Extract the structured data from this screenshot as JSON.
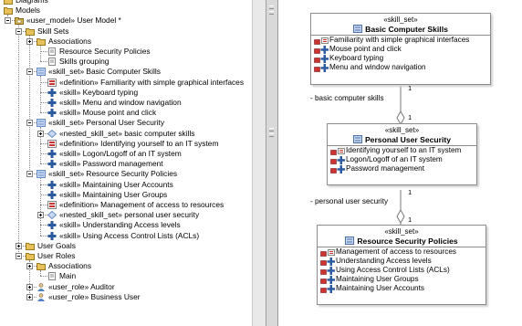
{
  "tree": {
    "rows": [
      {
        "label": "Diagrams",
        "indent": 1,
        "icon": "folder-icon",
        "expander": "plus"
      },
      {
        "label": "Models",
        "indent": 1,
        "icon": "folder-icon",
        "expander": "minus"
      },
      {
        "label": "«user_model» User Model *",
        "indent": 2,
        "icon": "package-icon",
        "expander": "minus"
      },
      {
        "label": "Skill Sets",
        "indent": 3,
        "icon": "folder-icon",
        "expander": "minus"
      },
      {
        "label": "Associations",
        "indent": 4,
        "icon": "folder-icon",
        "expander": "plus"
      },
      {
        "label": "Resource Security Policies",
        "indent": 5,
        "icon": "diagram-icon",
        "expander": ""
      },
      {
        "label": "Skills grouping",
        "indent": 5,
        "icon": "diagram-icon",
        "expander": ""
      },
      {
        "label": "«skill_set» Basic Computer Skills",
        "indent": 4,
        "icon": "skill-set-icon",
        "expander": "minus"
      },
      {
        "label": "«definition» Familiarity with simple graphical interfaces",
        "indent": 5,
        "icon": "definition-icon",
        "expander": ""
      },
      {
        "label": "«skill» Keyboard typing",
        "indent": 5,
        "icon": "skill-icon",
        "expander": ""
      },
      {
        "label": "«skill» Menu and window navigation",
        "indent": 5,
        "icon": "skill-icon",
        "expander": ""
      },
      {
        "label": "«skill» Mouse point and click",
        "indent": 5,
        "icon": "skill-icon",
        "expander": ""
      },
      {
        "label": "«skill_set» Personal User Security",
        "indent": 4,
        "icon": "skill-set-icon",
        "expander": "minus"
      },
      {
        "label": "«nested_skill_set» basic computer skills",
        "indent": 5,
        "icon": "nested-skill-set-icon",
        "expander": "plus"
      },
      {
        "label": "«definition» Identifying yourself to an IT system",
        "indent": 5,
        "icon": "definition-icon",
        "expander": ""
      },
      {
        "label": "«skill» Logon/Logoff of an IT system",
        "indent": 5,
        "icon": "skill-icon",
        "expander": ""
      },
      {
        "label": "«skill» Password management",
        "indent": 5,
        "icon": "skill-icon",
        "expander": ""
      },
      {
        "label": "«skill_set» Resource Security Policies",
        "indent": 4,
        "icon": "skill-set-icon",
        "expander": "minus"
      },
      {
        "label": "«skill» Maintaining User Accounts",
        "indent": 5,
        "icon": "skill-icon",
        "expander": ""
      },
      {
        "label": "«skill» Maintaining User Groups",
        "indent": 5,
        "icon": "skill-icon",
        "expander": ""
      },
      {
        "label": "«definition» Management of access to resources",
        "indent": 5,
        "icon": "definition-icon",
        "expander": ""
      },
      {
        "label": "«nested_skill_set» personal user security",
        "indent": 5,
        "icon": "nested-skill-set-icon",
        "expander": "plus"
      },
      {
        "label": "«skill» Understanding Access levels",
        "indent": 5,
        "icon": "skill-icon",
        "expander": ""
      },
      {
        "label": "«skill» Using Access Control Lists (ACLs)",
        "indent": 5,
        "icon": "skill-icon",
        "expander": ""
      },
      {
        "label": "User Goals",
        "indent": 3,
        "icon": "folder-icon",
        "expander": "plus"
      },
      {
        "label": "User Roles",
        "indent": 3,
        "icon": "folder-icon",
        "expander": "minus"
      },
      {
        "label": "Associations",
        "indent": 4,
        "icon": "folder-icon",
        "expander": "plus"
      },
      {
        "label": "Main",
        "indent": 5,
        "icon": "diagram-icon",
        "expander": ""
      },
      {
        "label": "«user_role» Auditor",
        "indent": 4,
        "icon": "user-role-icon",
        "expander": "plus"
      },
      {
        "label": "«user_role» Business User",
        "indent": 4,
        "icon": "user-role-icon",
        "expander": "plus"
      }
    ]
  },
  "diagram": {
    "classes": [
      {
        "stereotype": "«skill_set»",
        "name": "Basic Computer Skills",
        "items": [
          {
            "text": "Familiarity with simple graphical interfaces",
            "icon": "definition-icon"
          },
          {
            "text": "Mouse point and click",
            "icon": "skill-icon"
          },
          {
            "text": "Keyboard typing",
            "icon": "skill-icon"
          },
          {
            "text": "Menu and window navigation",
            "icon": "skill-icon"
          }
        ]
      },
      {
        "stereotype": "«skill_set»",
        "name": "Personal User Security",
        "items": [
          {
            "text": "Identifying yourself to an IT system",
            "icon": "definition-icon"
          },
          {
            "text": "Logon/Logoff of an IT system",
            "icon": "skill-icon"
          },
          {
            "text": "Password management",
            "icon": "skill-icon"
          }
        ]
      },
      {
        "stereotype": "«skill_set»",
        "name": "Resource Security Policies",
        "items": [
          {
            "text": "Management of access to resources",
            "icon": "definition-icon"
          },
          {
            "text": "Understanding Access levels",
            "icon": "skill-icon"
          },
          {
            "text": "Using Access Control Lists (ACLs)",
            "icon": "skill-icon"
          },
          {
            "text": "Maintaining User Groups",
            "icon": "skill-icon"
          },
          {
            "text": "Maintaining User Accounts",
            "icon": "skill-icon"
          }
        ]
      }
    ],
    "associations": [
      {
        "role": "- basic computer skills",
        "mult_top": "1",
        "mult_bottom": "1"
      },
      {
        "role": "- personal user security",
        "mult_top": "1",
        "mult_bottom": "1"
      }
    ]
  },
  "colors": {
    "folder": "#e8c15a",
    "skill": "#2c5aa0",
    "definition": "#cc3333",
    "skill_set": "#6a8fc8"
  }
}
